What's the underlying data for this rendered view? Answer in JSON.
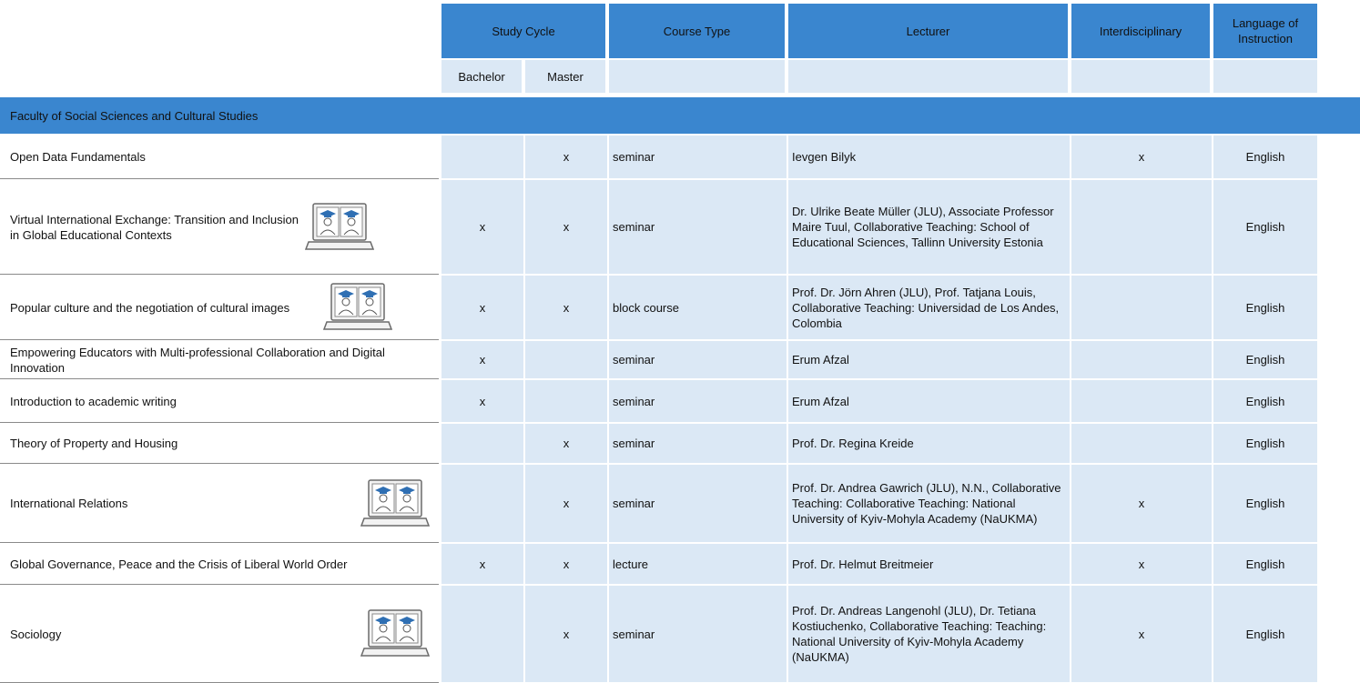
{
  "header": {
    "study_cycle": "Study Cycle",
    "course_type": "Course Type",
    "lecturer": "Lecturer",
    "interdisciplinary": "Interdisciplinary",
    "language": "Language of Instruction",
    "bachelor": "Bachelor",
    "master": "Master"
  },
  "section": {
    "title": "Faculty of Social Sciences and Cultural Studies"
  },
  "courses": [
    {
      "name": "Open Data Fundamentals",
      "bachelor": "",
      "master": "x",
      "type": "seminar",
      "lecturer": "Ievgen Bilyk",
      "interdisciplinary": "x",
      "language": "English",
      "virtual": false
    },
    {
      "name": "Virtual International Exchange: Transition and  Inclusion in Global Educational Contexts",
      "bachelor": "x",
      "master": "x",
      "type": "seminar",
      "lecturer": "Dr. Ulrike Beate Müller (JLU), Associate Professor Maire Tuul, Collaborative Teaching: School of Educational Sciences, Tallinn University Estonia",
      "interdisciplinary": "",
      "language": "English",
      "virtual": true
    },
    {
      "name": "Popular culture and the negotiation of cultural images",
      "bachelor": "x",
      "master": "x",
      "type": "block course",
      "lecturer": "Prof. Dr. Jörn Ahren (JLU), Prof. Tatjana Louis, Collaborative Teaching: Universidad de Los Andes, Colombia",
      "interdisciplinary": "",
      "language": "English",
      "virtual": true
    },
    {
      "name": "Empowering Educators with Multi-professional Collaboration and Digital Innovation",
      "bachelor": "x",
      "master": "",
      "type": "seminar",
      "lecturer": "Erum Afzal",
      "interdisciplinary": "",
      "language": "English",
      "virtual": false
    },
    {
      "name": "Introduction to academic writing",
      "bachelor": "x",
      "master": "",
      "type": "seminar",
      "lecturer": "Erum Afzal",
      "interdisciplinary": "",
      "language": "English",
      "virtual": false
    },
    {
      "name": "Theory of Property and Housing",
      "bachelor": "",
      "master": "x",
      "type": "seminar",
      "lecturer": "Prof. Dr. Regina Kreide",
      "interdisciplinary": "",
      "language": "English",
      "virtual": false
    },
    {
      "name": "International Relations",
      "bachelor": "",
      "master": "x",
      "type": "seminar",
      "lecturer": "Prof. Dr. Andrea Gawrich (JLU), N.N., Collaborative Teaching: Collaborative Teaching: National University of Kyiv-Mohyla Academy (NaUKMA)",
      "interdisciplinary": "x",
      "language": "English",
      "virtual": true
    },
    {
      "name": "Global Governance, Peace and the Crisis of Liberal World Order",
      "bachelor": "x",
      "master": "x",
      "type": "lecture",
      "lecturer": "Prof. Dr. Helmut Breitmeier",
      "interdisciplinary": "x",
      "language": "English",
      "virtual": false
    },
    {
      "name": "Sociology",
      "bachelor": "",
      "master": "x",
      "type": "seminar",
      "lecturer": "Prof. Dr. Andreas Langenohl (JLU), Dr. Tetiana Kostiuchenko, Collaborative Teaching: Teaching: National University of Kyiv-Mohyla Academy (NaUKMA)",
      "interdisciplinary": "x",
      "language": "English",
      "virtual": true
    }
  ]
}
